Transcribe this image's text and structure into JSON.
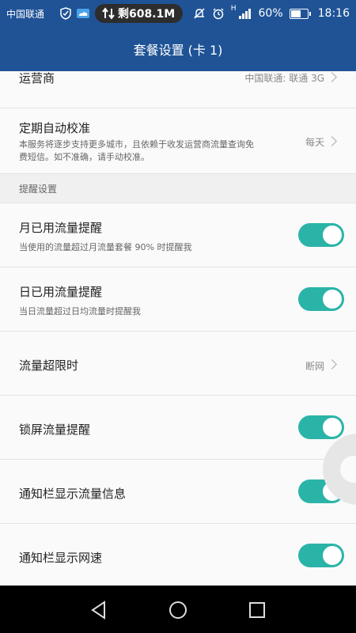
{
  "status_bar": {
    "carrier": "中国联通",
    "data_remaining": "剩608.1M",
    "battery": "60%",
    "time": "18:16",
    "signal_type": "H"
  },
  "title": "套餐设置 (卡 1)",
  "rows": {
    "carrier": {
      "title": "运营商",
      "value": "中国联通: 联通 3G"
    },
    "auto_calibrate": {
      "title": "定期自动校准",
      "desc": "本服务将逐步支持更多城市，且依赖于收发运营商流量查询免费短信。如不准确，请手动校准。",
      "value": "每天"
    },
    "section": "提醒设置",
    "monthly": {
      "title": "月已用流量提醒",
      "desc": "当使用的流量超过月流量套餐 90% 时提醒我",
      "on": true
    },
    "daily": {
      "title": "日已用流量提醒",
      "desc": "当日流量超过日均流量时提醒我",
      "on": true
    },
    "over_limit": {
      "title": "流量超限时",
      "value": "断网"
    },
    "lockscreen": {
      "title": "锁屏流量提醒",
      "on": true
    },
    "notif_traffic": {
      "title": "通知栏显示流量信息",
      "on": true
    },
    "notif_speed": {
      "title": "通知栏显示网速",
      "on": true
    }
  },
  "colors": {
    "header": "#1f5396",
    "toggle_on": "#2ab4a8",
    "nav": "#000000"
  },
  "icons": [
    "shield-icon",
    "weather-icon",
    "sync-icon",
    "mute-icon",
    "alarm-icon",
    "signal-icon",
    "battery-icon",
    "back-icon",
    "home-icon",
    "recents-icon"
  ]
}
